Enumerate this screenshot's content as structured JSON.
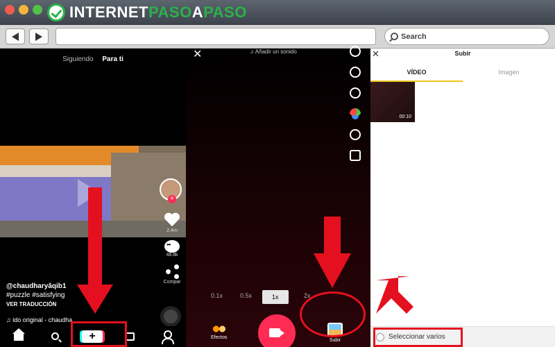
{
  "browser": {
    "logo": {
      "part1": "INTERNET",
      "part2": "PASO",
      "part3": "A",
      "part4": "PASO"
    },
    "search": {
      "placeholder": "Search"
    },
    "url_value": ""
  },
  "feed": {
    "tabs": [
      "Siguiendo",
      "Para ti"
    ],
    "actions": {
      "likes": "2.4m",
      "comments": "48.8k",
      "share": "Compar"
    },
    "caption": {
      "user": "@chaudharyâqib1",
      "hashtags": "#puzzle #satisfying",
      "translate": "VER TRADUCCIÓN",
      "music": "♫   ido original - chaudha"
    }
  },
  "camera": {
    "sound": "♫  Añadir un sonido",
    "speeds": [
      "0.1x",
      "0.5x",
      "1x",
      "2x"
    ],
    "effects_label": "Efectos",
    "upload_label": "Subir"
  },
  "upload": {
    "title": "Subir",
    "tabs": [
      "VÍDEO",
      "Imagen"
    ],
    "video_duration": "00:10",
    "select_multiple": "Seleccionar varios"
  },
  "colors": {
    "accent": "#fe2c55",
    "annotation": "#e5101f",
    "tab_underline": "#f0c419"
  },
  "icons": [
    "home-icon",
    "search-icon",
    "create-icon",
    "inbox-icon",
    "profile-icon",
    "heart-icon",
    "comment-icon",
    "share-icon",
    "flip-icon",
    "speed-icon",
    "beauty-icon",
    "filter-icon",
    "timer-icon",
    "grid-icon",
    "camera-icon",
    "close-icon"
  ]
}
